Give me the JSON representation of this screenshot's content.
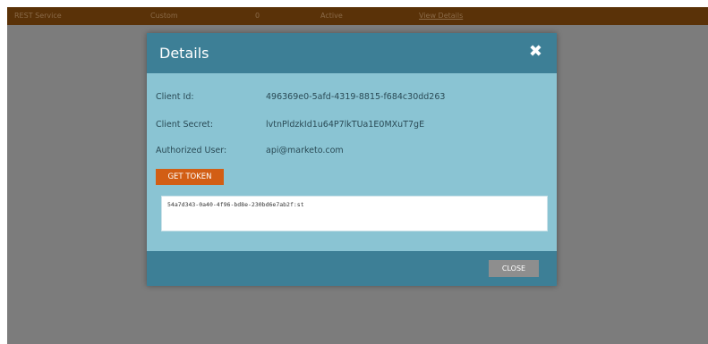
{
  "background_row": {
    "col1": "REST Service",
    "col2": "Custom",
    "col3": "0",
    "col4": "Active",
    "link": "View Details"
  },
  "modal": {
    "title": "Details",
    "close_icon": "close-icon",
    "fields": [
      {
        "label": "Client Id:",
        "value": "496369e0-5afd-4319-8815-f684c30dd263"
      },
      {
        "label": "Client Secret:",
        "value": "lvtnPldzkId1u64P7lkTUa1E0MXuT7gE"
      },
      {
        "label": "Authorized User:",
        "value": "api@marketo.com"
      }
    ],
    "get_token_label": "GET TOKEN",
    "token_value": "54a7d343-0a40-4f96-bd8e-230bd6e7ab2f:st",
    "close_button_label": "CLOSE"
  },
  "colors": {
    "header": "#3d7f96",
    "body": "#8ac4d3",
    "accent": "#d25e14",
    "backdrop": "#7c7c7c",
    "row_bar": "#5a3208"
  }
}
